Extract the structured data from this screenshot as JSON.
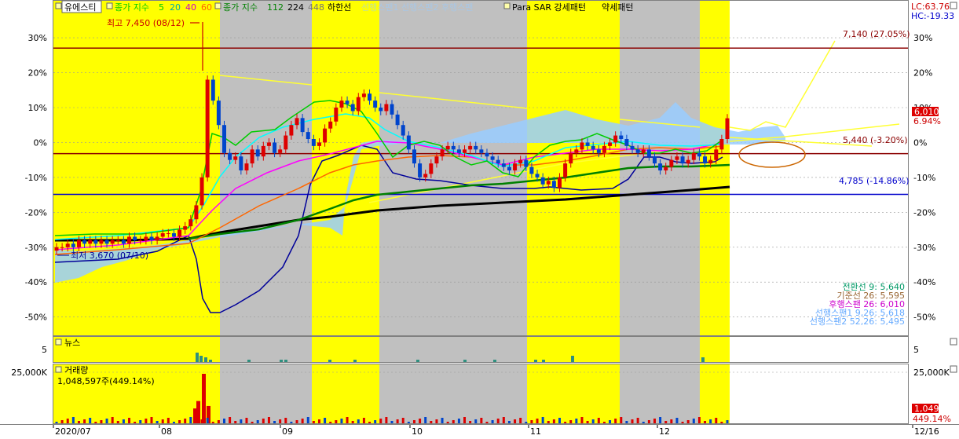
{
  "legend": {
    "stock": "유에스티",
    "ma_label": "종가 지수",
    "ma_periods": [
      "5",
      "20",
      "40",
      "60"
    ],
    "ma2_label": "종가 지수",
    "ma2_periods": [
      "112",
      "224",
      "448"
    ],
    "ichimoku": "하한선",
    "ichimoku_faded": "선행스팬1 선행스팬2 후행스팬",
    "psar": "Para SAR 강세패턴",
    "psar_bear": "약세패턴"
  },
  "panels": {
    "news_label": "뉴스",
    "volume_label": "거래량",
    "volume_value": "1,048,597주(449.14%)"
  },
  "price_markers": {
    "high": "최고 7,450 (08/12)",
    "low": "최저 3,670 (07/10)",
    "lc": "LC:63.76",
    "hc": "HC:-19.33",
    "current_price": "6,010",
    "current_pct": "6.94%",
    "line_top": "7,140 (27.05%)",
    "line_mid": "5,440 (-3.20%)",
    "line_low": "4,785 (-14.86%)",
    "vol_badge": "1,049K",
    "vol_pct": "449.14%"
  },
  "ichimoku_values": [
    {
      "label": "전환선 9: 5,640",
      "color": "#009966"
    },
    {
      "label": "기준선 26: 5,595",
      "color": "#996633"
    },
    {
      "label": "후행스팬 26: 6,010",
      "color": "#cc00cc"
    },
    {
      "label": "선행스팬1 9,26: 5,618",
      "color": "#66aaff"
    },
    {
      "label": "선행스팬2 52,26: 5,495",
      "color": "#66aaff"
    }
  ],
  "chart_data": {
    "type": "candlestick",
    "y_axis_unit": "percent",
    "ylim": [
      -53,
      37
    ],
    "y_ticks": [
      "30%",
      "20%",
      "10%",
      "0%",
      "-10%",
      "-20%",
      "-30%",
      "-40%",
      "-50%"
    ],
    "news_ticks": [
      "5"
    ],
    "volume_ticks": [
      "25,000K"
    ],
    "x_ticks": [
      "2020/07",
      "08",
      "09",
      "10",
      "11",
      "12",
      "12/16"
    ],
    "horizontal_lines": [
      {
        "value": 27.05,
        "label": "7,140 (27.05%)",
        "color": "#8b0000"
      },
      {
        "value": -3.2,
        "label": "5,440 (-3.20%)",
        "color": "#8b0000"
      },
      {
        "value": -14.86,
        "label": "4,785 (-14.86%)",
        "color": "#0000cc"
      }
    ],
    "closes_pct": [
      -30,
      -30,
      -29,
      -30,
      -28,
      -29,
      -28,
      -29,
      -28,
      -29,
      -28,
      -28,
      -29,
      -27,
      -28,
      -28,
      -27,
      -28,
      -27,
      -26,
      -26,
      -27,
      -25,
      -24,
      -22,
      -18,
      -10,
      18,
      12,
      5,
      -3,
      -5,
      -4,
      -8,
      -6,
      -2,
      -4,
      -1,
      0,
      -3,
      -2,
      2,
      5,
      7,
      3,
      1,
      -1,
      0,
      4,
      6,
      10,
      12,
      11,
      9,
      13,
      14,
      12,
      10,
      9,
      11,
      8,
      5,
      2,
      -2,
      -6,
      -10,
      -9,
      -6,
      -4,
      -2,
      -1,
      -2,
      -3,
      -2,
      -1,
      -2,
      -3,
      -4,
      -5,
      -6,
      -7,
      -8,
      -6,
      -5,
      -7,
      -9,
      -10,
      -12,
      -11,
      -13,
      -10,
      -6,
      -3,
      -2,
      0,
      -1,
      -2,
      -3,
      -1,
      0,
      2,
      1,
      -1,
      -2,
      -3,
      -2,
      -4,
      -6,
      -8,
      -7,
      -5,
      -4,
      -6,
      -5,
      -3,
      -4,
      -6,
      -5,
      -2,
      1,
      6.94
    ],
    "volume_spikes": [
      {
        "date": "08/12",
        "rel": 1.0
      },
      {
        "date": "08/13",
        "rel": 0.45
      },
      {
        "date": "08/14",
        "rel": 0.35
      },
      {
        "date": "08/11",
        "rel": 0.3
      }
    ]
  }
}
